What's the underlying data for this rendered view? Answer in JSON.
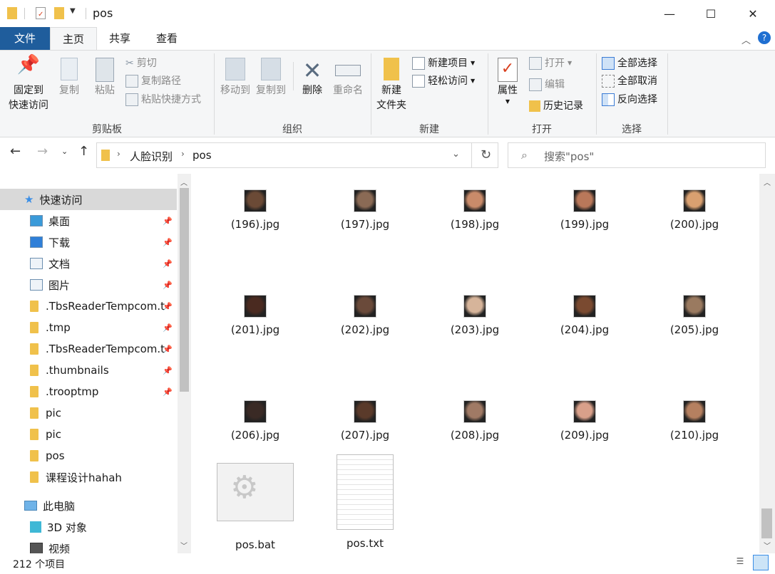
{
  "window": {
    "title": "pos",
    "minimize": "—",
    "maximize": "☐",
    "close": "✕"
  },
  "tabs": [
    {
      "label": "文件"
    },
    {
      "label": "主页"
    },
    {
      "label": "共享"
    },
    {
      "label": "查看"
    }
  ],
  "ribbon": {
    "clipboard": {
      "pin_line1": "固定到",
      "pin_line2": "快速访问",
      "copy": "复制",
      "paste": "粘贴",
      "cut": "剪切",
      "copy_path": "复制路径",
      "paste_shortcut": "粘贴快捷方式",
      "label": "剪贴板"
    },
    "organize": {
      "move_to": "移动到",
      "copy_to": "复制到",
      "delete": "删除",
      "rename": "重命名",
      "label": "组织"
    },
    "new": {
      "new_folder_line1": "新建",
      "new_folder_line2": "文件夹",
      "new_item": "新建项目",
      "easy_access": "轻松访问",
      "label": "新建"
    },
    "open": {
      "properties": "属性",
      "open": "打开",
      "edit": "编辑",
      "history": "历史记录",
      "label": "打开"
    },
    "select": {
      "select_all": "全部选择",
      "select_none": "全部取消",
      "invert": "反向选择",
      "label": "选择"
    }
  },
  "address": {
    "crumbs": [
      "人脸识别",
      "pos"
    ],
    "search_placeholder": "搜索\"pos\""
  },
  "nav": {
    "quick_access": "快速访问",
    "items": [
      {
        "label": "桌面",
        "pinned": true
      },
      {
        "label": "下载",
        "pinned": true
      },
      {
        "label": "文档",
        "pinned": true
      },
      {
        "label": "图片",
        "pinned": true
      },
      {
        "label": ".TbsReaderTempcom.t",
        "pinned": true
      },
      {
        "label": ".tmp",
        "pinned": true
      },
      {
        "label": ".TbsReaderTempcom.t",
        "pinned": true
      },
      {
        "label": ".thumbnails",
        "pinned": true
      },
      {
        "label": ".trooptmp",
        "pinned": true
      },
      {
        "label": "pic",
        "pinned": false
      },
      {
        "label": "pic",
        "pinned": false
      },
      {
        "label": "pos",
        "pinned": false
      },
      {
        "label": "课程设计hahah",
        "pinned": false
      }
    ],
    "this_pc": "此电脑",
    "pc_items": [
      {
        "label": "3D 对象"
      },
      {
        "label": "视频"
      }
    ]
  },
  "files": [
    {
      "name": "(196).jpg"
    },
    {
      "name": "(197).jpg"
    },
    {
      "name": "(198).jpg"
    },
    {
      "name": "(199).jpg"
    },
    {
      "name": "(200).jpg"
    },
    {
      "name": "(201).jpg"
    },
    {
      "name": "(202).jpg"
    },
    {
      "name": "(203).jpg"
    },
    {
      "name": "(204).jpg"
    },
    {
      "name": "(205).jpg"
    },
    {
      "name": "(206).jpg"
    },
    {
      "name": "(207).jpg"
    },
    {
      "name": "(208).jpg"
    },
    {
      "name": "(209).jpg"
    },
    {
      "name": "(210).jpg"
    },
    {
      "name": "pos.bat"
    },
    {
      "name": "pos.txt"
    }
  ],
  "status": {
    "count": "212 个项目"
  },
  "colors": {
    "file_tab": "#1f5d9c",
    "folder": "#f0c14b",
    "accent": "#0078d7"
  }
}
